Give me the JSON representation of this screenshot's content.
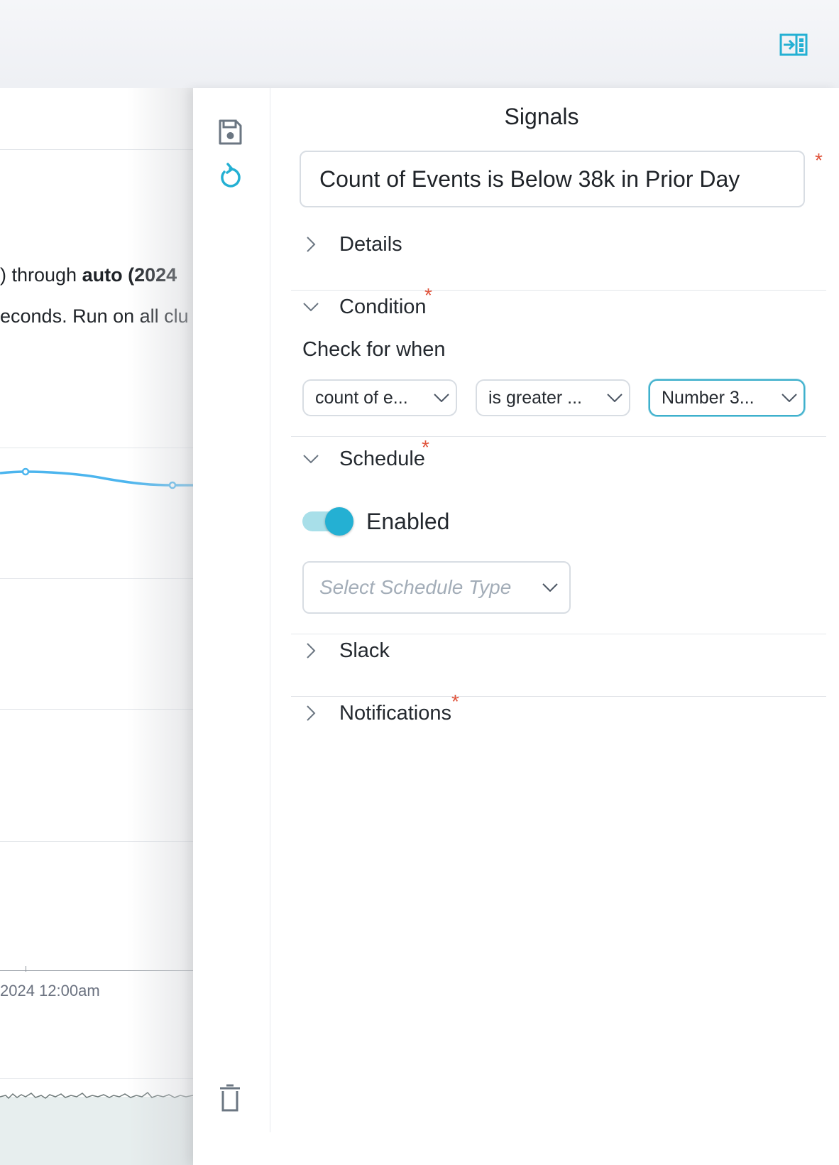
{
  "background": {
    "text_line_1_prefix": ") through ",
    "text_line_1_bold": "auto (2024",
    "text_line_2": "econds. Run on all clu",
    "axis_label": "2024 12:00am"
  },
  "drawer": {
    "title": "Signals",
    "name_value": "Count of Events is Below 38k in Prior Day",
    "required_mark": "*",
    "sections": {
      "details": "Details",
      "condition": "Condition",
      "schedule": "Schedule",
      "slack": "Slack",
      "notifications": "Notifications"
    },
    "condition": {
      "check_label": "Check for when",
      "field_select": "count of e...",
      "operator_select": "is greater ...",
      "value_select": "Number 3..."
    },
    "schedule": {
      "enabled_label": "Enabled",
      "enabled": true,
      "type_placeholder": "Select Schedule Type"
    }
  },
  "icons": {
    "panel_toggle": "collapse-panel-icon",
    "save": "save-icon",
    "reset": "reset-icon",
    "delete": "trash-icon"
  },
  "colors": {
    "accent": "#24b0d3",
    "required": "#e0533b",
    "chart_line": "#4cb5ee"
  }
}
